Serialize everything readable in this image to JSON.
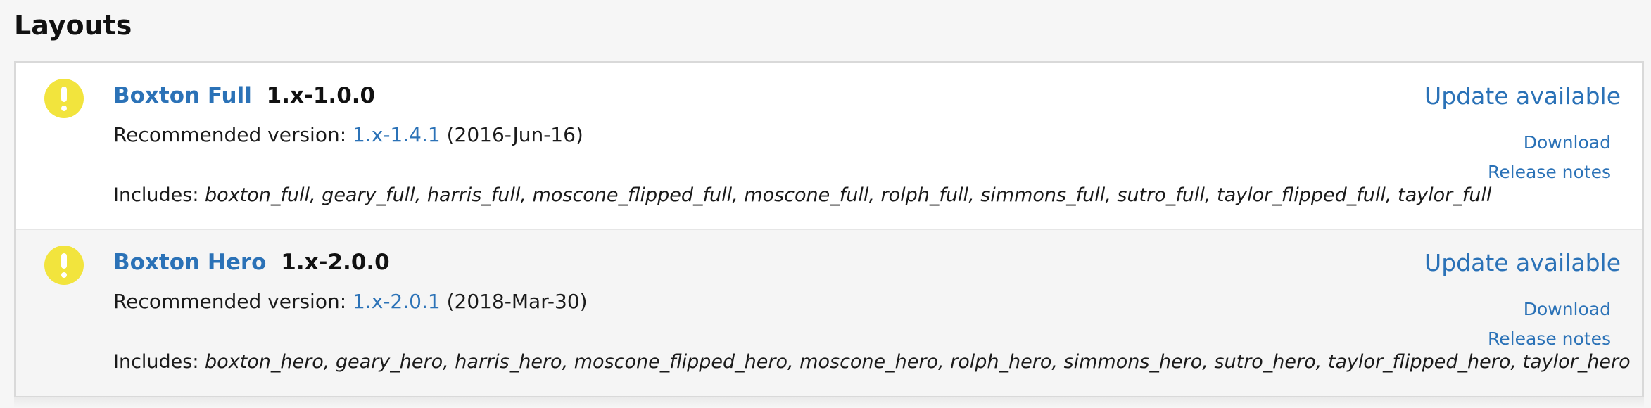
{
  "section": {
    "title": "Layouts"
  },
  "projects": [
    {
      "name": "Boxton Full",
      "version": "1.x-1.0.0",
      "recommended_label": "Recommended version:",
      "recommended_version": "1.x-1.4.1",
      "recommended_date": "(2016-Jun-16)",
      "status": "Update available",
      "download_label": "Download",
      "release_notes_label": "Release notes",
      "includes_label": "Includes:",
      "includes": "boxton_full, geary_full, harris_full, moscone_flipped_full, moscone_full, rolph_full, simmons_full, sutro_full, taylor_flipped_full, taylor_full"
    },
    {
      "name": "Boxton Hero",
      "version": "1.x-2.0.0",
      "recommended_label": "Recommended version:",
      "recommended_version": "1.x-2.0.1",
      "recommended_date": "(2018-Mar-30)",
      "status": "Update available",
      "download_label": "Download",
      "release_notes_label": "Release notes",
      "includes_label": "Includes:",
      "includes": "boxton_hero, geary_hero, harris_hero, moscone_flipped_hero, moscone_hero, rolph_hero, simmons_hero, sutro_hero, taylor_flipped_hero, taylor_hero"
    }
  ],
  "colors": {
    "link": "#2b72b7",
    "warning": "#f2e43d",
    "row_alt": "#f5f5f5"
  },
  "icons": {
    "status": "warning-icon"
  }
}
